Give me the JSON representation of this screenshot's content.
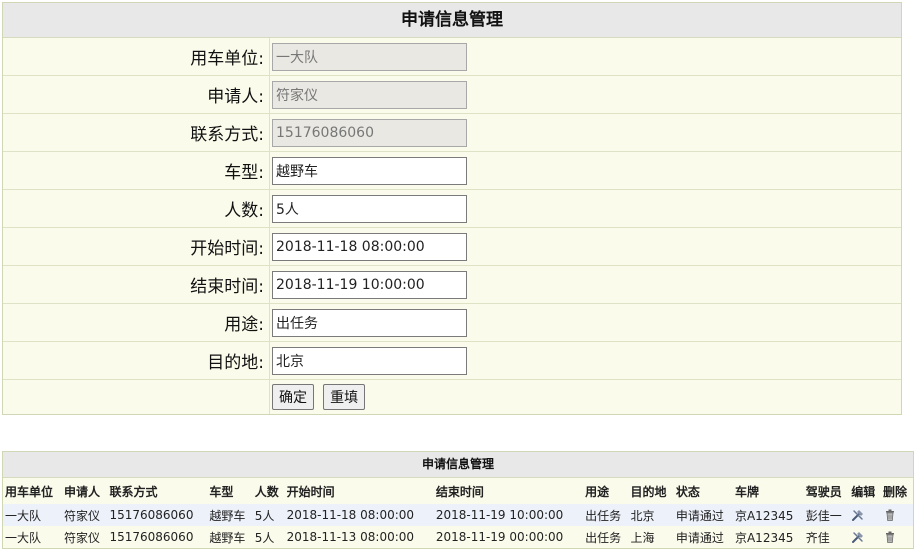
{
  "form": {
    "title": "申请信息管理",
    "fields": [
      {
        "label": "用车单位:",
        "value": "一大队",
        "readonly": true
      },
      {
        "label": "申请人:",
        "value": "符家仪",
        "readonly": true
      },
      {
        "label": "联系方式:",
        "value": "15176086060",
        "readonly": true
      },
      {
        "label": "车型:",
        "value": "越野车",
        "readonly": false
      },
      {
        "label": "人数:",
        "value": "5人",
        "readonly": false
      },
      {
        "label": "开始时间:",
        "value": "2018-11-18 08:00:00",
        "readonly": false
      },
      {
        "label": "结束时间:",
        "value": "2018-11-19 10:00:00",
        "readonly": false
      },
      {
        "label": "用途:",
        "value": "出任务",
        "readonly": false
      },
      {
        "label": "目的地:",
        "value": "北京",
        "readonly": false
      }
    ],
    "confirm_label": "确定",
    "reset_label": "重填"
  },
  "list": {
    "title": "申请信息管理",
    "headers": [
      "用车单位",
      "申请人",
      "联系方式",
      "车型",
      "人数",
      "开始时间",
      "结束时间",
      "用途",
      "目的地",
      "状态",
      "车牌",
      "驾驶员",
      "编辑",
      "删除"
    ],
    "rows": [
      [
        "一大队",
        "符家仪",
        "15176086060",
        "越野车",
        "5人",
        "2018-11-18 08:00:00",
        "2018-11-19 10:00:00",
        "出任务",
        "北京",
        "申请通过",
        "京A12345",
        "彭佳一"
      ],
      [
        "一大队",
        "符家仪",
        "15176086060",
        "越野车",
        "5人",
        "2018-11-13 08:00:00",
        "2018-11-19 00:00:00",
        "出任务",
        "上海",
        "申请通过",
        "京A12345",
        "齐佳"
      ]
    ]
  },
  "icons": {
    "edit": "edit-tools-icon",
    "delete": "trash-icon"
  }
}
